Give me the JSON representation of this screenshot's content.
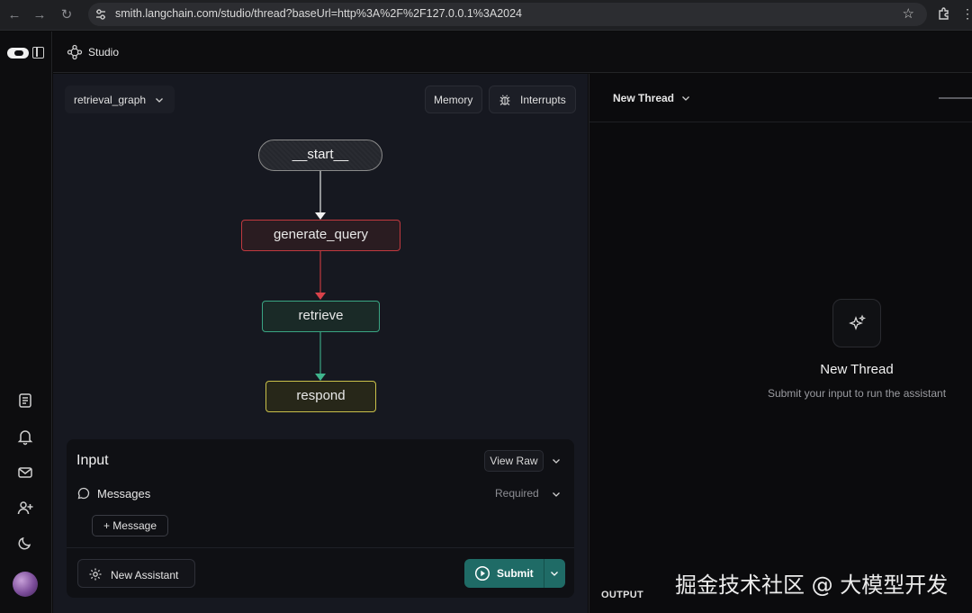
{
  "browser": {
    "url": "smith.langchain.com/studio/thread?baseUrl=http%3A%2F%2F127.0.0.1%3A2024",
    "icons": [
      "back-icon",
      "forward-icon",
      "reload-icon",
      "site-settings-icon",
      "bookmark-star-icon",
      "extensions-icon",
      "menu-kebab-icon"
    ]
  },
  "topbar": {
    "label": "Studio"
  },
  "graph": {
    "selector_label": "retrieval_graph",
    "memory_label": "Memory",
    "interrupts_label": "Interrupts",
    "nodes": [
      {
        "id": "start",
        "label": "__start__",
        "color": "#a6a6a6"
      },
      {
        "id": "generate_query",
        "label": "generate_query",
        "color": "#c0393f"
      },
      {
        "id": "retrieve",
        "label": "retrieve",
        "color": "#3aa583"
      },
      {
        "id": "respond",
        "label": "respond",
        "color": "#c9c04a"
      }
    ]
  },
  "input": {
    "title": "Input",
    "view_raw_label": "View Raw",
    "messages_label": "Messages",
    "required_label": "Required",
    "add_message_label": "+ Message",
    "new_assistant_label": "New Assistant",
    "submit_label": "Submit"
  },
  "thread": {
    "title": "New Thread",
    "empty_title": "New Thread",
    "empty_subtitle": "Submit your input to run the assistant",
    "output_label": "OUTPUT"
  },
  "watermark": "掘金技术社区 @ 大模型开发",
  "colors": {
    "accent_submit": "#1f6b66",
    "panel_bg": "#161820"
  }
}
